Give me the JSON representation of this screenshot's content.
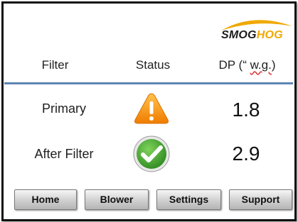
{
  "logo": {
    "text_dark": "SMOG",
    "text_accent": "HOG"
  },
  "headers": {
    "filter": "Filter",
    "status": "Status",
    "dp_prefix": "DP (“ ",
    "dp_unit": "w.g.",
    "dp_suffix": ")"
  },
  "rows": [
    {
      "filter": "Primary",
      "status_icon": "warning-icon",
      "dp": "1.8"
    },
    {
      "filter": "After Filter",
      "status_icon": "check-icon",
      "dp": "2.9"
    }
  ],
  "nav": {
    "home": "Home",
    "blower": "Blower",
    "settings": "Settings",
    "support": "Support"
  },
  "colors": {
    "accent": "#f0a800",
    "divider": "#5f86b3",
    "check_green": "#3a9a2a",
    "warning_orange": "#f29a1a"
  }
}
